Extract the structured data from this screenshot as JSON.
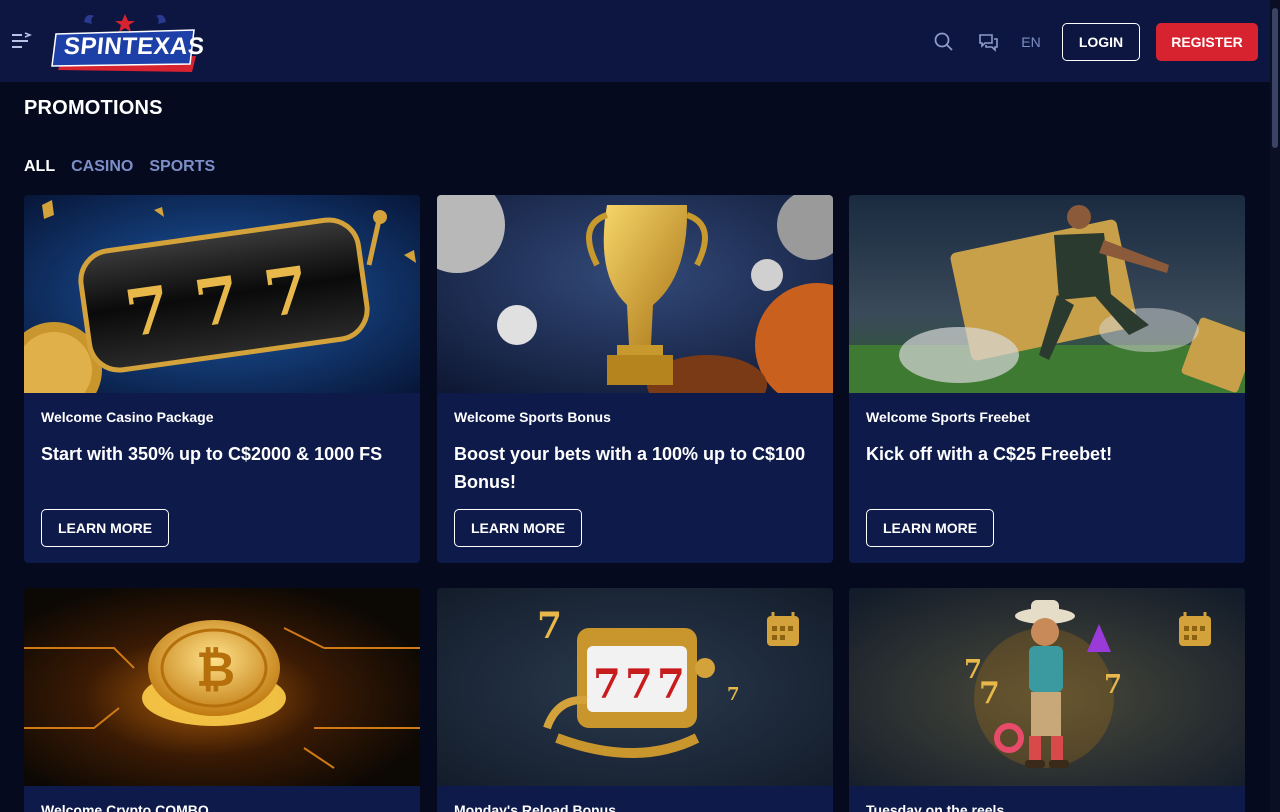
{
  "header": {
    "brand": "SPINTEXAS",
    "language": "EN",
    "login_label": "LOGIN",
    "register_label": "REGISTER",
    "icons": [
      "menu-toggle-icon",
      "search-icon",
      "chat-icon"
    ]
  },
  "page": {
    "title": "PROMOTIONS"
  },
  "filters": [
    {
      "label": "ALL",
      "active": true
    },
    {
      "label": "CASINO",
      "active": false
    },
    {
      "label": "SPORTS",
      "active": false
    }
  ],
  "promotions": [
    {
      "category": "Welcome Casino Package",
      "title": "Start with 350% up to C$2000 & 1000 FS",
      "button": "LEARN MORE",
      "image": "slot-machine-777"
    },
    {
      "category": "Welcome Sports Bonus",
      "title": "Boost your bets with a 100% up to C$100 Bonus!",
      "button": "LEARN MORE",
      "image": "golden-trophy-balls"
    },
    {
      "category": "Welcome Sports Freebet",
      "title": "Kick off with a C$25 Freebet!",
      "button": "LEARN MORE",
      "image": "football-player-tickets"
    },
    {
      "category": "Welcome Crypto COMBO",
      "image": "glowing-bitcoin-coin"
    },
    {
      "category": "Monday's Reload Bonus",
      "image": "golden-slot-machine-calendar"
    },
    {
      "category": "Tuesday on the reels",
      "image": "cowboy-character-calendar"
    }
  ],
  "colors": {
    "background": "#050a1f",
    "header": "#0c1640",
    "card": "#0e1a4a",
    "register": "#d7232f",
    "muted_link": "#7d8fc8"
  }
}
